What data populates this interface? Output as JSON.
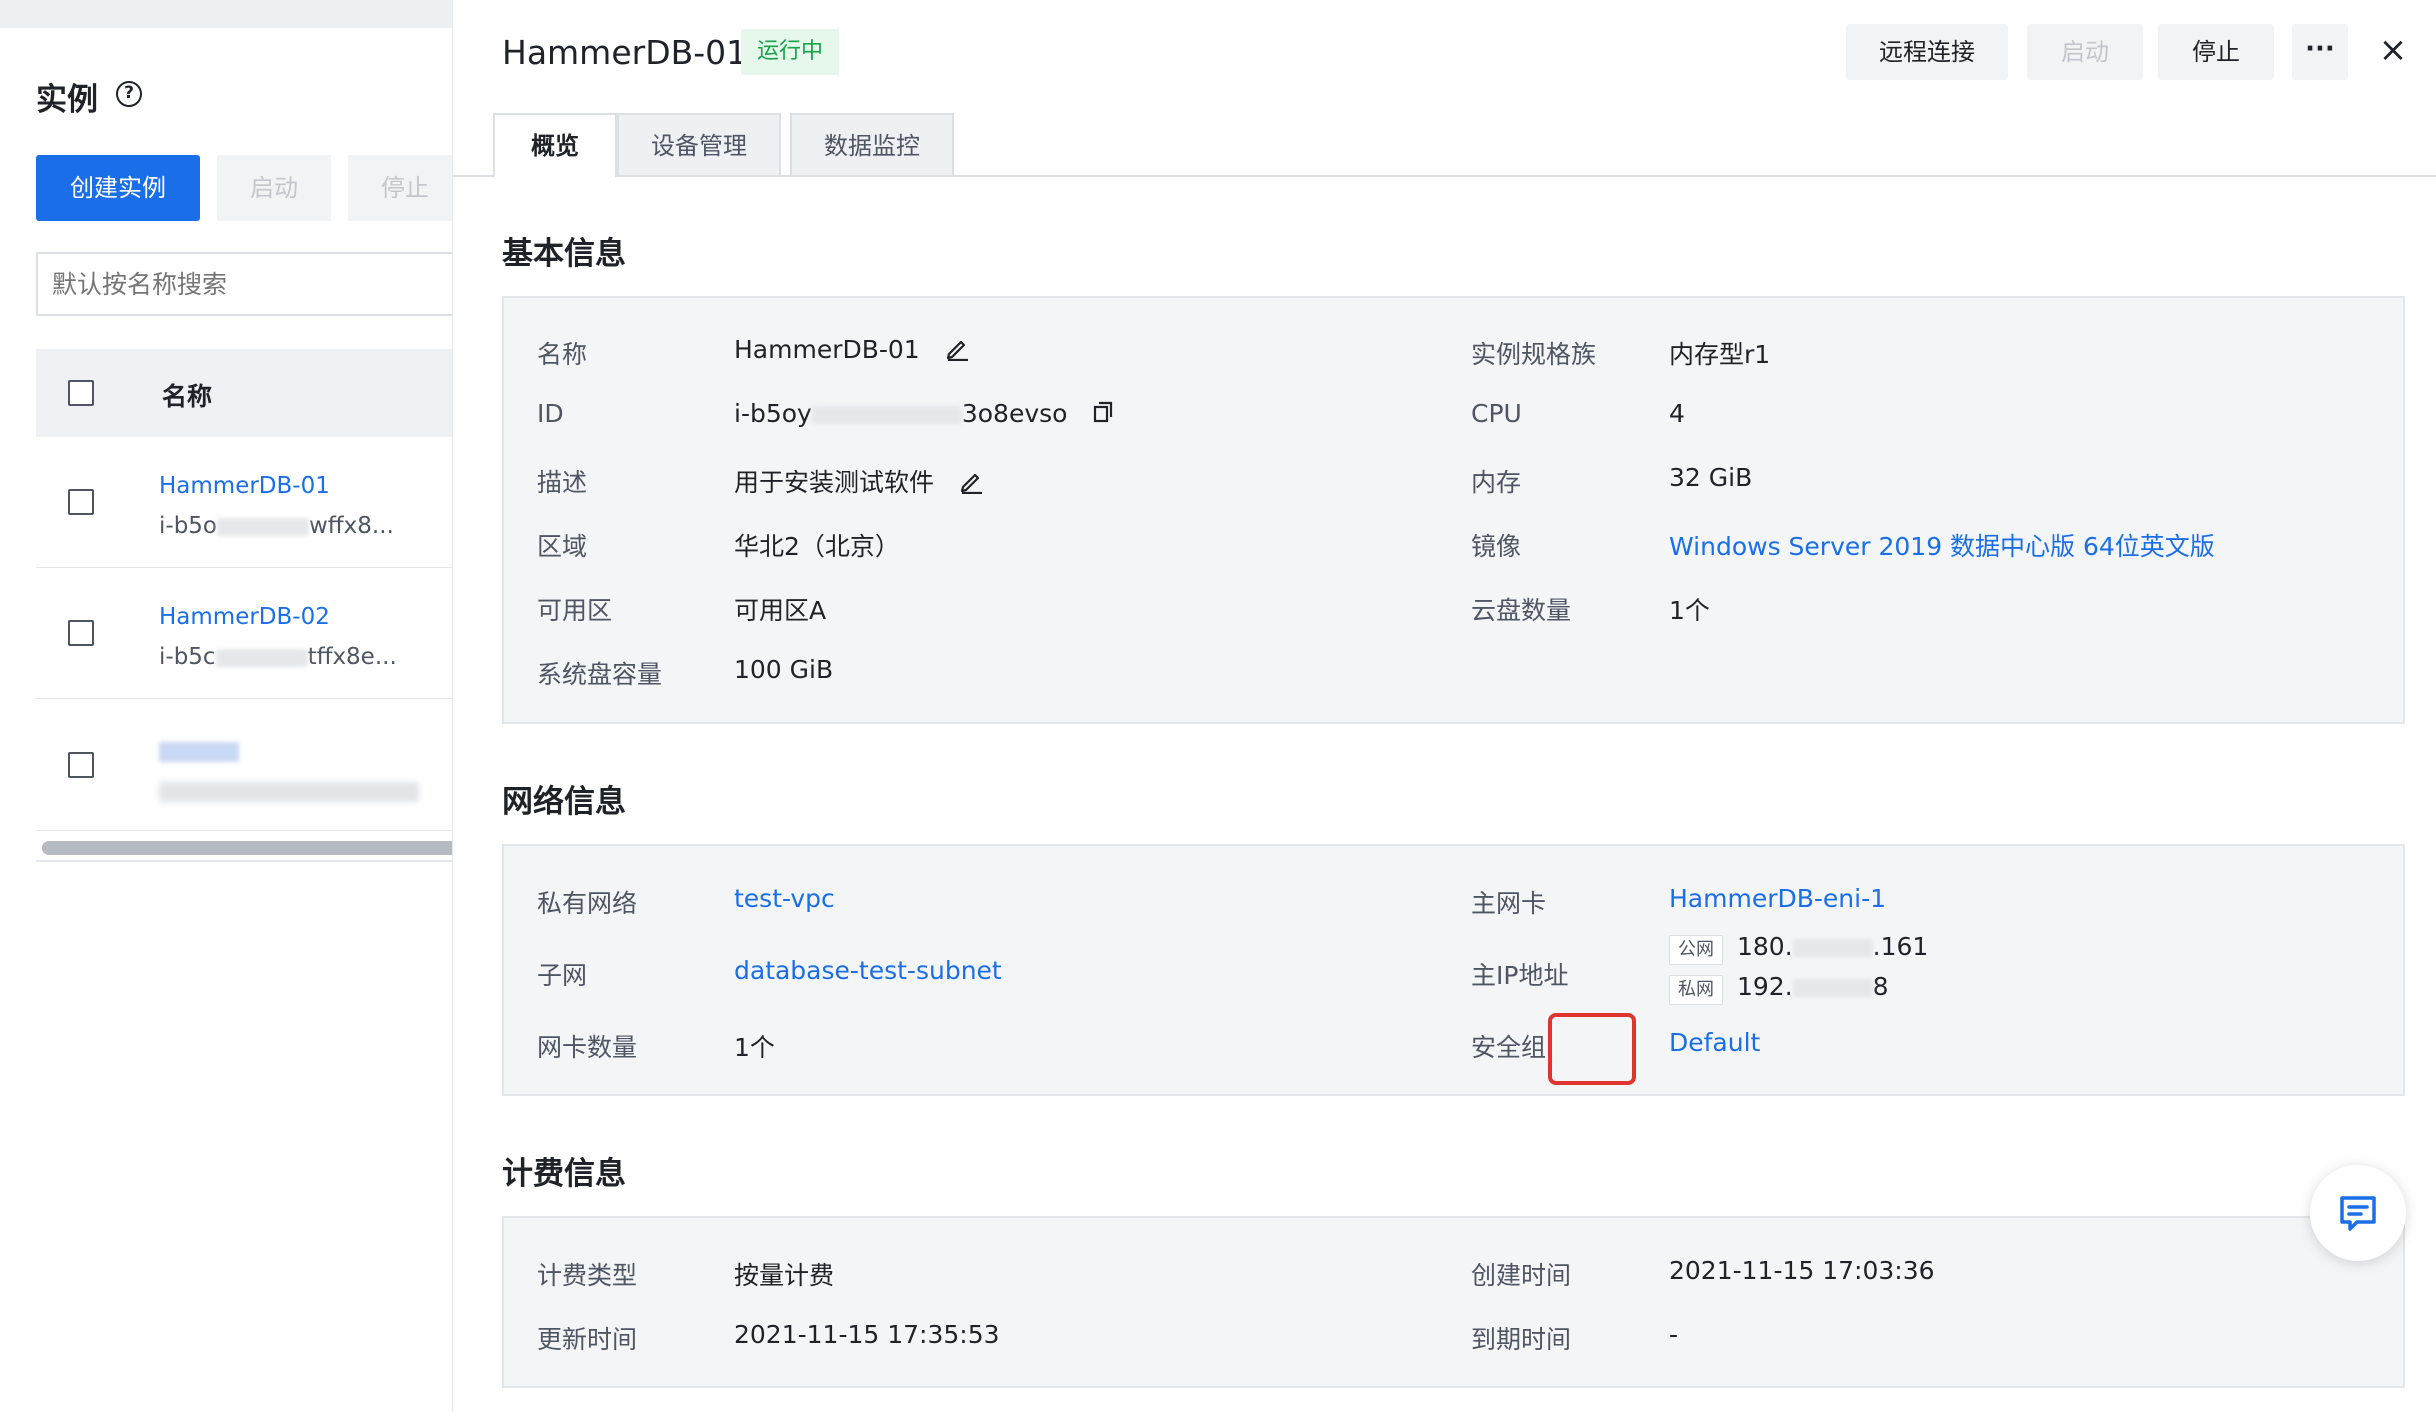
{
  "left": {
    "title": "实例",
    "help_icon": "question-circle-icon",
    "create_label": "创建实例",
    "start_label": "启动",
    "stop_label": "停止",
    "search_placeholder": "默认按名称搜索",
    "column_name": "名称",
    "rows": [
      {
        "name": "HammerDB-01",
        "id_prefix": "i-b5o",
        "id_suffix": "wffx8..."
      },
      {
        "name": "HammerDB-02",
        "id_prefix": "i-b5c",
        "id_suffix": "tffx8e..."
      }
    ]
  },
  "header": {
    "instance_name": "HammerDB-01",
    "status": "运行中",
    "status_color": "#19a34a",
    "remote_label": "远程连接",
    "start_label": "启动",
    "stop_label": "停止",
    "more_label": "···",
    "close_label": "×"
  },
  "tabs": [
    {
      "label": "概览",
      "active": true
    },
    {
      "label": "设备管理",
      "active": false
    },
    {
      "label": "数据监控",
      "active": false
    }
  ],
  "basic": {
    "title": "基本信息",
    "name_label": "名称",
    "name_value": "HammerDB-01",
    "id_label": "ID",
    "id_prefix": "i-b5oy",
    "id_suffix": "3o8evso",
    "desc_label": "描述",
    "desc_value": "用于安装测试软件",
    "region_label": "区域",
    "region_value": "华北2（北京）",
    "zone_label": "可用区",
    "zone_value": "可用区A",
    "sysdisk_label": "系统盘容量",
    "sysdisk_value": "100 GiB",
    "spec_label": "实例规格族",
    "spec_value": "内存型r1",
    "cpu_label": "CPU",
    "cpu_value": "4",
    "mem_label": "内存",
    "mem_value": "32 GiB",
    "image_label": "镜像",
    "image_value": "Windows Server 2019 数据中心版 64位英文版",
    "disks_label": "云盘数量",
    "disks_value": "1个"
  },
  "network": {
    "title": "网络信息",
    "vpc_label": "私有网络",
    "vpc_value": "test-vpc",
    "subnet_label": "子网",
    "subnet_value": "database-test-subnet",
    "nic_count_label": "网卡数量",
    "nic_count_value": "1个",
    "primary_nic_label": "主网卡",
    "primary_nic_value": "HammerDB-eni-1",
    "primary_ip_label": "主IP地址",
    "public_tag": "公网",
    "public_ip_prefix": "180.",
    "public_ip_suffix": ".161",
    "private_tag": "私网",
    "private_ip_prefix": "192.",
    "private_ip_suffix": "8",
    "sg_label": "安全组",
    "sg_value": "Default"
  },
  "billing": {
    "title": "计费信息",
    "type_label": "计费类型",
    "type_value": "按量计费",
    "updated_label": "更新时间",
    "updated_value": "2021-11-15 17:35:53",
    "created_label": "创建时间",
    "created_value": "2021-11-15 17:03:36",
    "expire_label": "到期时间",
    "expire_value": "-"
  },
  "colors": {
    "accent": "#1a6fe8",
    "highlight": "#e0342f"
  }
}
